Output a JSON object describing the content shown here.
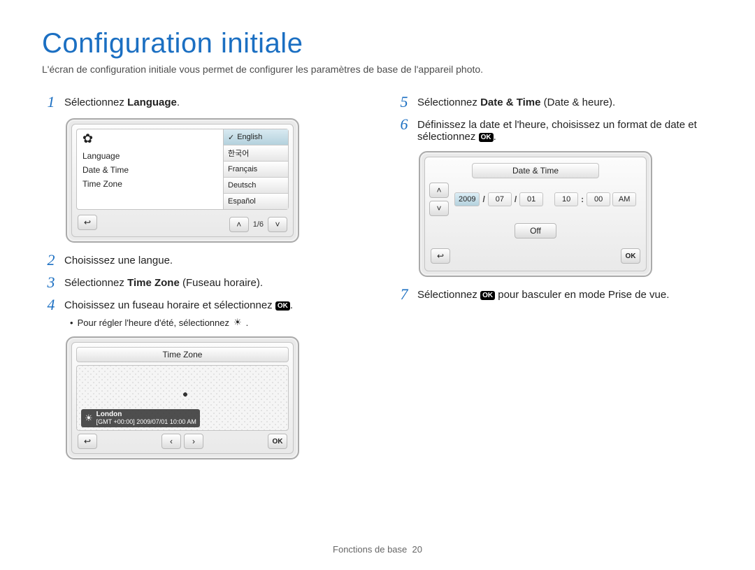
{
  "header": {
    "title": "Configuration initiale",
    "intro": "L'écran de configuration initiale vous permet de configurer les paramètres de base de l'appareil photo."
  },
  "steps": {
    "1": {
      "prefix": "Sélectionnez ",
      "bold": "Language",
      "suffix": "."
    },
    "2": {
      "text": "Choisissez une langue."
    },
    "3": {
      "prefix": "Sélectionnez ",
      "bold": "Time Zone",
      "suffix": " (Fuseau horaire)."
    },
    "4": {
      "prefix": "Choisissez un fuseau horaire et sélectionnez ",
      "ok": true,
      "suffix": "."
    },
    "4_bullet": {
      "text": "Pour régler l'heure d'été, sélectionnez "
    },
    "5": {
      "prefix": "Sélectionnez ",
      "bold": "Date & Time",
      "suffix": " (Date & heure)."
    },
    "6": {
      "prefix": "Définissez la date et l'heure, choisissez un format de date et sélectionnez ",
      "ok": true,
      "suffix": "."
    },
    "7": {
      "prefix": "Sélectionnez ",
      "ok": true,
      "suffix": " pour basculer en mode Prise de vue."
    }
  },
  "panel_language": {
    "menu": {
      "item1": "Language",
      "item2": "Date & Time",
      "item3": "Time Zone"
    },
    "options": {
      "english": "English",
      "korean": "한국어",
      "francais": "Français",
      "deutsch": "Deutsch",
      "espanol": "Español"
    },
    "pager": "1/6"
  },
  "panel_timezone": {
    "title": "Time Zone",
    "city": "London",
    "gmt": "[GMT +00:00] 2009/07/01 10:00 AM",
    "ok": "OK"
  },
  "panel_datetime": {
    "title": "Date & Time",
    "year": "2009",
    "month": "07",
    "day": "01",
    "hour": "10",
    "minute": "00",
    "ampm": "AM",
    "sep_date": "/",
    "sep_time": ":",
    "off": "Off",
    "ok": "OK"
  },
  "footer": {
    "section": "Fonctions de base",
    "page": "20"
  },
  "icons": {
    "back": "↩",
    "up": "˄",
    "down": "˅",
    "left": "‹",
    "right": "›",
    "gear": "✿",
    "check": "✓",
    "sun": "☀"
  }
}
